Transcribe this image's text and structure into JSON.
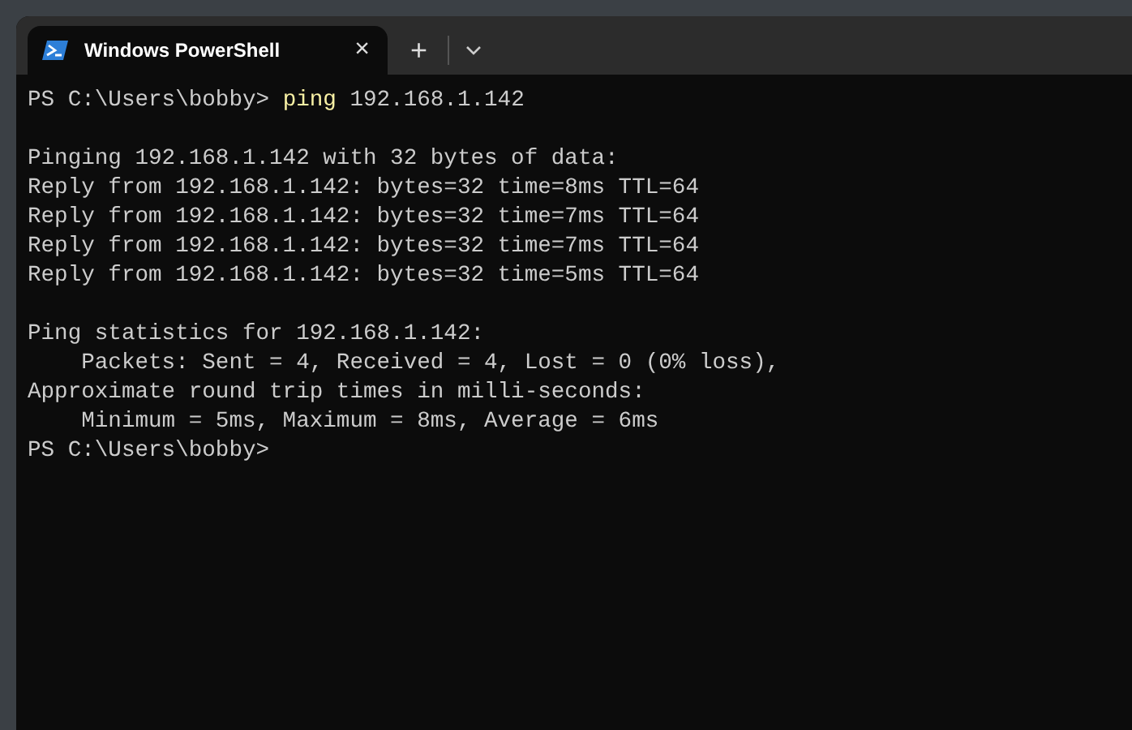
{
  "tab": {
    "title": "Windows PowerShell",
    "close": "×",
    "selected": true
  },
  "new_tab": "+",
  "lines": [
    {
      "kind": "command",
      "prompt": "PS C:\\Users\\bobby> ",
      "command": "ping",
      "args": " 192.168.1.142"
    },
    {
      "kind": "blank"
    },
    {
      "kind": "output",
      "text": "Pinging 192.168.1.142 with 32 bytes of data:"
    },
    {
      "kind": "output",
      "text": "Reply from 192.168.1.142: bytes=32 time=8ms TTL=64"
    },
    {
      "kind": "output",
      "text": "Reply from 192.168.1.142: bytes=32 time=7ms TTL=64"
    },
    {
      "kind": "output",
      "text": "Reply from 192.168.1.142: bytes=32 time=7ms TTL=64"
    },
    {
      "kind": "output",
      "text": "Reply from 192.168.1.142: bytes=32 time=5ms TTL=64"
    },
    {
      "kind": "blank"
    },
    {
      "kind": "output",
      "text": "Ping statistics for 192.168.1.142:"
    },
    {
      "kind": "output",
      "text": "    Packets: Sent = 4, Received = 4, Lost = 0 (0% loss),"
    },
    {
      "kind": "output",
      "text": "Approximate round trip times in milli-seconds:"
    },
    {
      "kind": "output",
      "text": "    Minimum = 5ms, Maximum = 8ms, Average = 6ms"
    },
    {
      "kind": "output",
      "text": "PS C:\\Users\\bobby>"
    }
  ]
}
